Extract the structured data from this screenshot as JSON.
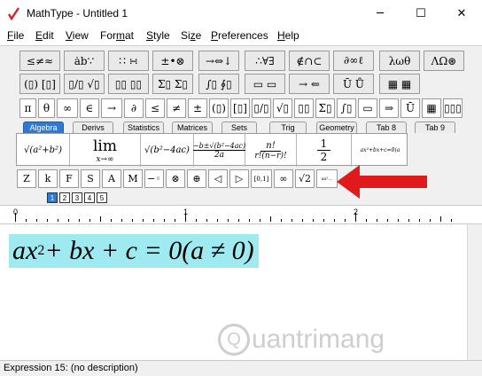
{
  "window": {
    "title": "MathType - Untitled 1",
    "minimize": "─",
    "maximize": "☐",
    "close": "✕"
  },
  "menu": [
    {
      "u": "F",
      "rest": "ile"
    },
    {
      "u": "E",
      "rest": "dit"
    },
    {
      "u": "V",
      "rest": "iew"
    },
    {
      "pre": "For",
      "u": "m",
      "rest": "at"
    },
    {
      "u": "S",
      "rest": "tyle"
    },
    {
      "pre": "Si",
      "u": "z",
      "rest": "e"
    },
    {
      "u": "P",
      "rest": "references"
    },
    {
      "u": "H",
      "rest": "elp"
    }
  ],
  "palette_row1": [
    "≤≠≈",
    "ȧb∵",
    "∷ ∺",
    "±•⊗",
    "→⇔↓",
    "∴∀∃",
    "∉∩⊂",
    "∂∞ℓ",
    "λωθ",
    "ΛΩ⊛"
  ],
  "palette_row2": [
    "(▯) [▯]",
    "▯/▯ √▯",
    "▯▯ ▯▯",
    "Σ▯ Σ▯",
    "∫▯ ∮▯",
    "▭ ▭",
    "→ ⇐",
    "Ū Ů",
    "▦ ▦"
  ],
  "palette_row3": [
    "π",
    "θ",
    "∞",
    "∈",
    "→",
    "∂",
    "≤",
    "≠",
    "±",
    "(▯)",
    "[▯]",
    "▯/▯",
    "√▯",
    "▯▯",
    "Σ▯",
    "∫▯",
    "▭",
    "⇒",
    "Ū",
    "▦",
    "▯▯▯"
  ],
  "tabs": [
    "Algebra",
    "Derivs",
    "Statistics",
    "Matrices",
    "Sets",
    "Trig",
    "Geometry",
    "Tab 8",
    "Tab 9"
  ],
  "templates": {
    "t1": "√(a²+b²)",
    "t2_top": "lim",
    "t2_bottom": "x→∞",
    "t3": "√(b²−4ac)",
    "t4_top": "−b±√(b²−4ac)",
    "t4_bottom": "2a",
    "t5_top": "n!",
    "t5_bottom": "r!(n−r)!",
    "t6_top": "1",
    "t6_bottom": "2",
    "t7": "ax²+bx+c=0(a"
  },
  "symbols_row": [
    "Z",
    "k",
    "F",
    "S",
    "A",
    "M",
    "−◦",
    "⊗",
    "⊕",
    "◁",
    "▷",
    "[0,1]",
    "∞",
    "√2",
    "ax²…"
  ],
  "size_tabs": [
    "1",
    "2",
    "3",
    "4",
    "5"
  ],
  "ruler": {
    "labels": [
      "0",
      "1",
      "2"
    ]
  },
  "expression": {
    "pre": "ax",
    "sup": "2",
    "mid": " + bx + c = 0(a ≠ 0)"
  },
  "watermark": {
    "text": "uantrimang",
    "logo": "Q"
  },
  "status": "Expression 15: (no description)",
  "colors": {
    "accent": "#2c7ad6",
    "highlight": "#9feaf0",
    "arrow": "#e0191b"
  }
}
